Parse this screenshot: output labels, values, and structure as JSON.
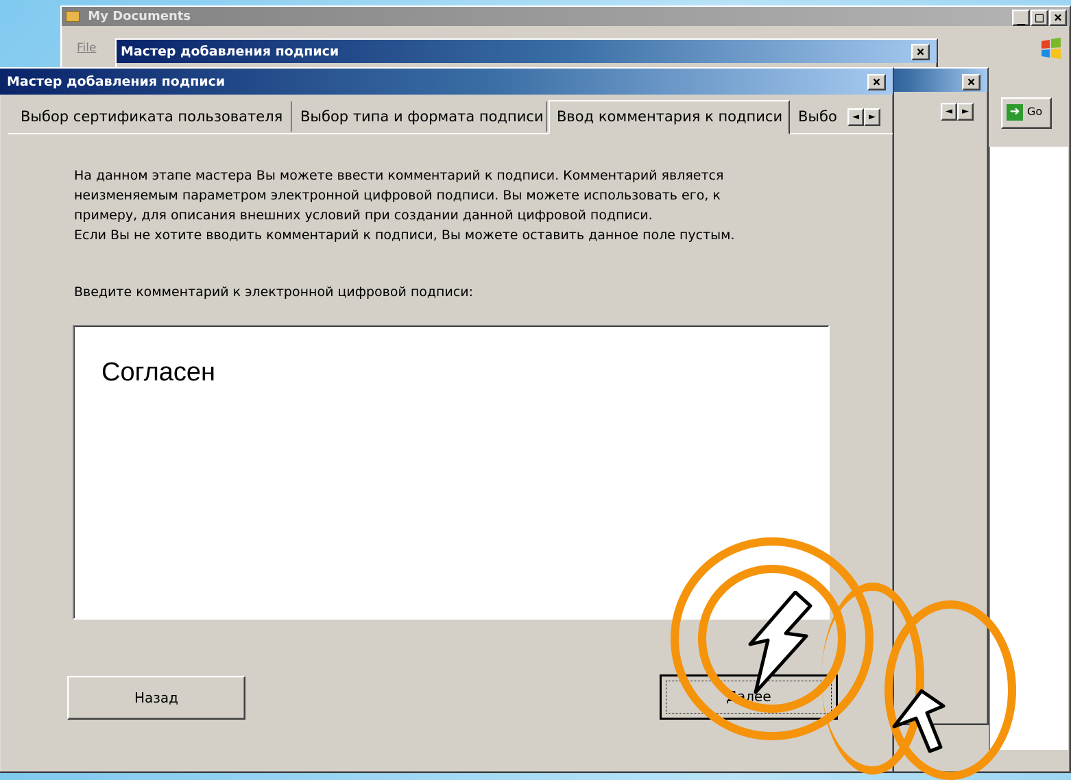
{
  "explorer": {
    "title": "My Documents",
    "menu_file": "File",
    "go_label": "Go",
    "controls": [
      "_",
      "□",
      "×"
    ]
  },
  "dialog_back2": {
    "title": "Мастер добавления подписи",
    "close": "×"
  },
  "dialog_back1": {
    "title": "",
    "close": "×"
  },
  "wizard": {
    "title": "Мастер добавления подписи",
    "close": "×",
    "tabs": [
      {
        "label": "Выбор сертификата пользователя",
        "active": false
      },
      {
        "label": "Выбор типа и формата подписи",
        "active": false
      },
      {
        "label": "Ввод комментария к подписи",
        "active": true
      },
      {
        "label": "Выбо",
        "active": false
      }
    ],
    "scroll_left": "◄",
    "scroll_right": "►",
    "description_lines": [
      "На данном этапе мастера Вы можете ввести комментарий к подписи. Комментарий является",
      "неизменяемым параметром электронной цифровой подписи. Вы можете использовать его, к",
      "примеру, для описания внешних условий при создании данной цифровой подписи.",
      "Если Вы не хотите вводить комментарий к подписи, Вы можете оставить данное поле пустым."
    ],
    "comment_label": "Введите комментарий к электронной цифровой подписи:",
    "comment_value": "Согласен",
    "back_button": "Назад",
    "next_button": "Далее"
  },
  "colors": {
    "highlight_ring": "#f5930b",
    "titlebar_active": "#0a246a",
    "window_face": "#d4d0c8"
  }
}
